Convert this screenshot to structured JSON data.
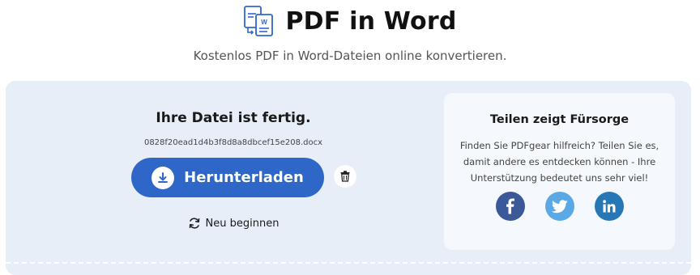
{
  "header": {
    "title": "PDF in Word",
    "subtitle": "Kostenlos PDF in Word-Dateien online konvertieren."
  },
  "result": {
    "heading": "Ihre Datei ist fertig.",
    "filename": "0828f20ead1d4b3f8d8a8dbcef15e208.docx",
    "download_label": "Herunterladen",
    "restart_label": "Neu beginnen"
  },
  "share": {
    "title": "Teilen zeigt Fürsorge",
    "text": "Finden Sie PDFgear hilfreich? Teilen Sie es, damit andere es entdecken können - Ihre Unterstützung bedeutet uns sehr viel!",
    "networks": [
      {
        "name": "facebook-icon",
        "color": "#3b5998",
        "glyph": "f"
      },
      {
        "name": "twitter-icon",
        "color": "#5aa9e6",
        "glyph": ""
      },
      {
        "name": "linkedin-icon",
        "color": "#2577b5",
        "glyph": "in"
      }
    ]
  },
  "colors": {
    "accent": "#2f67c9",
    "panel": "#e8eef8",
    "card": "#f5f8fd"
  }
}
